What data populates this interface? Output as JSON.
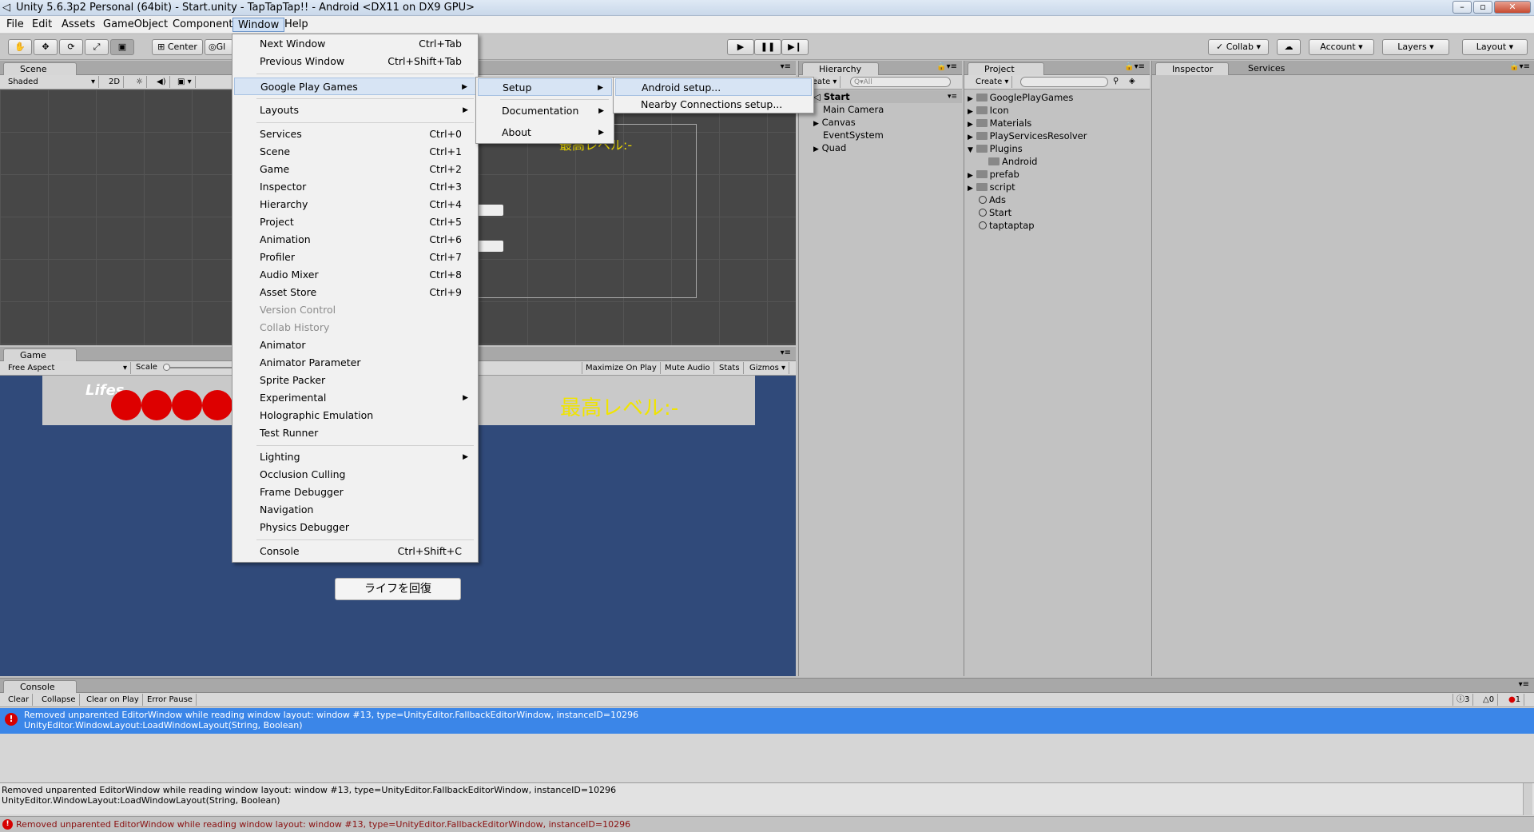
{
  "window": {
    "title": "Unity 5.6.3p2 Personal (64bit) - Start.unity - TapTapTap!! - Android <DX11 on DX9 GPU>"
  },
  "menubar": [
    "File",
    "Edit",
    "Assets",
    "GameObject",
    "Component",
    "Window",
    "Help"
  ],
  "toolbar": {
    "center": "Center",
    "global": "Gl",
    "collab": "Collab",
    "account": "Account",
    "layers": "Layers",
    "layout": "Layout"
  },
  "scene": {
    "tab": "Scene",
    "shading": "Shaded",
    "mode2d": "2D",
    "canvas_text": "最高レベル:-"
  },
  "game": {
    "tab": "Game",
    "aspect": "Free Aspect",
    "scale": "Scale",
    "buttons": [
      "Maximize On Play",
      "Mute Audio",
      "Stats",
      "Gizmos"
    ],
    "lifes": "Lifes",
    "high_level": "最高レベル:-",
    "recover_button": "ライフを回復",
    "life_count": 4,
    "life_color": "#dd0000",
    "bg_color": "#304a7a"
  },
  "hierarchy": {
    "tab": "Hierarchy",
    "create": "Create",
    "search_placeholder": "Q▾All",
    "scene_name": "Start",
    "items": [
      "Main Camera",
      "Canvas",
      "EventSystem",
      "Quad"
    ]
  },
  "project": {
    "tab": "Project",
    "create": "Create",
    "items": [
      "GooglePlayGames",
      "Icon",
      "Materials",
      "PlayServicesResolver",
      "Plugins",
      "Android",
      "prefab",
      "script",
      "Ads",
      "Start",
      "taptaptap"
    ]
  },
  "inspector": {
    "tab": "Inspector",
    "services_tab": "Services"
  },
  "console": {
    "tab": "Console",
    "buttons": [
      "Clear",
      "Collapse",
      "Clear on Play",
      "Error Pause"
    ],
    "counts": {
      "info": "3",
      "warn": "0",
      "error": "1"
    },
    "entry_line1": "Removed unparented EditorWindow while reading window layout: window #13, type=UnityEditor.FallbackEditorWindow, instanceID=10296",
    "entry_line2": "UnityEditor.WindowLayout:LoadWindowLayout(String, Boolean)",
    "detail_line1": "Removed unparented EditorWindow while reading window layout: window #13, type=UnityEditor.FallbackEditorWindow, instanceID=10296",
    "detail_line2": "UnityEditor.WindowLayout:LoadWindowLayout(String, Boolean)",
    "status": "Removed unparented EditorWindow while reading window layout: window #13, type=UnityEditor.FallbackEditorWindow, instanceID=10296"
  },
  "window_menu": {
    "items": [
      {
        "label": "Next Window",
        "shortcut": "Ctrl+Tab"
      },
      {
        "label": "Previous Window",
        "shortcut": "Ctrl+Shift+Tab"
      },
      {
        "label": "Google Play Games",
        "shortcut": ""
      },
      {
        "label": "Layouts",
        "shortcut": ""
      },
      {
        "label": "Services",
        "shortcut": "Ctrl+0"
      },
      {
        "label": "Scene",
        "shortcut": "Ctrl+1"
      },
      {
        "label": "Game",
        "shortcut": "Ctrl+2"
      },
      {
        "label": "Inspector",
        "shortcut": "Ctrl+3"
      },
      {
        "label": "Hierarchy",
        "shortcut": "Ctrl+4"
      },
      {
        "label": "Project",
        "shortcut": "Ctrl+5"
      },
      {
        "label": "Animation",
        "shortcut": "Ctrl+6"
      },
      {
        "label": "Profiler",
        "shortcut": "Ctrl+7"
      },
      {
        "label": "Audio Mixer",
        "shortcut": "Ctrl+8"
      },
      {
        "label": "Asset Store",
        "shortcut": "Ctrl+9"
      },
      {
        "label": "Version Control",
        "shortcut": ""
      },
      {
        "label": "Collab History",
        "shortcut": ""
      },
      {
        "label": "Animator",
        "shortcut": ""
      },
      {
        "label": "Animator Parameter",
        "shortcut": ""
      },
      {
        "label": "Sprite Packer",
        "shortcut": ""
      },
      {
        "label": "Experimental",
        "shortcut": ""
      },
      {
        "label": "Holographic Emulation",
        "shortcut": ""
      },
      {
        "label": "Test Runner",
        "shortcut": ""
      },
      {
        "label": "Lighting",
        "shortcut": ""
      },
      {
        "label": "Occlusion Culling",
        "shortcut": ""
      },
      {
        "label": "Frame Debugger",
        "shortcut": ""
      },
      {
        "label": "Navigation",
        "shortcut": ""
      },
      {
        "label": "Physics Debugger",
        "shortcut": ""
      },
      {
        "label": "Console",
        "shortcut": "Ctrl+Shift+C"
      }
    ]
  },
  "gpg_menu": {
    "items": [
      "Setup",
      "Documentation",
      "About"
    ]
  },
  "setup_menu": {
    "items": [
      "Android setup...",
      "Nearby Connections setup..."
    ]
  },
  "colors": {
    "accent": "#3b86e8",
    "error": "#d60000"
  }
}
